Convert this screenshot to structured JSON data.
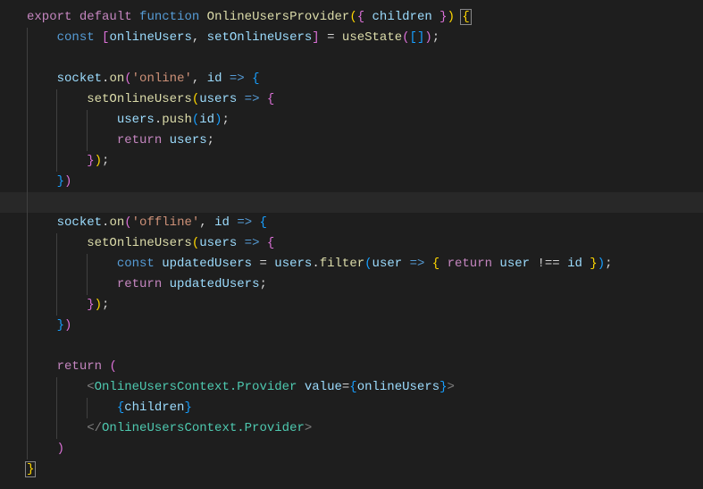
{
  "code": {
    "l1_export": "export",
    "l1_default": "default",
    "l1_function": "function",
    "l1_name": "OnlineUsersProvider",
    "l1_param": "children",
    "l2_const": "const",
    "l2_v1": "onlineUsers",
    "l2_v2": "setOnlineUsers",
    "l2_use": "useState",
    "l4_obj": "socket",
    "l4_on": "on",
    "l4_str": "'online'",
    "l4_id": "id",
    "l5_fn": "setOnlineUsers",
    "l5_p": "users",
    "l6_v": "users",
    "l6_m": "push",
    "l6_a": "id",
    "l7_ret": "return",
    "l7_v": "users",
    "l11_obj": "socket",
    "l11_on": "on",
    "l11_str": "'offline'",
    "l11_id": "id",
    "l12_fn": "setOnlineUsers",
    "l12_p": "users",
    "l13_const": "const",
    "l13_v": "updatedUsers",
    "l13_u": "users",
    "l13_m": "filter",
    "l13_p": "user",
    "l13_ret": "return",
    "l13_u2": "user",
    "l13_op": "!==",
    "l13_id": "id",
    "l14_ret": "return",
    "l14_v": "updatedUsers",
    "l18_ret": "return",
    "l19_tag": "OnlineUsersContext.Provider",
    "l19_attr": "value",
    "l19_val": "onlineUsers",
    "l20_v": "children",
    "l21_tag": "OnlineUsersContext.Provider"
  }
}
